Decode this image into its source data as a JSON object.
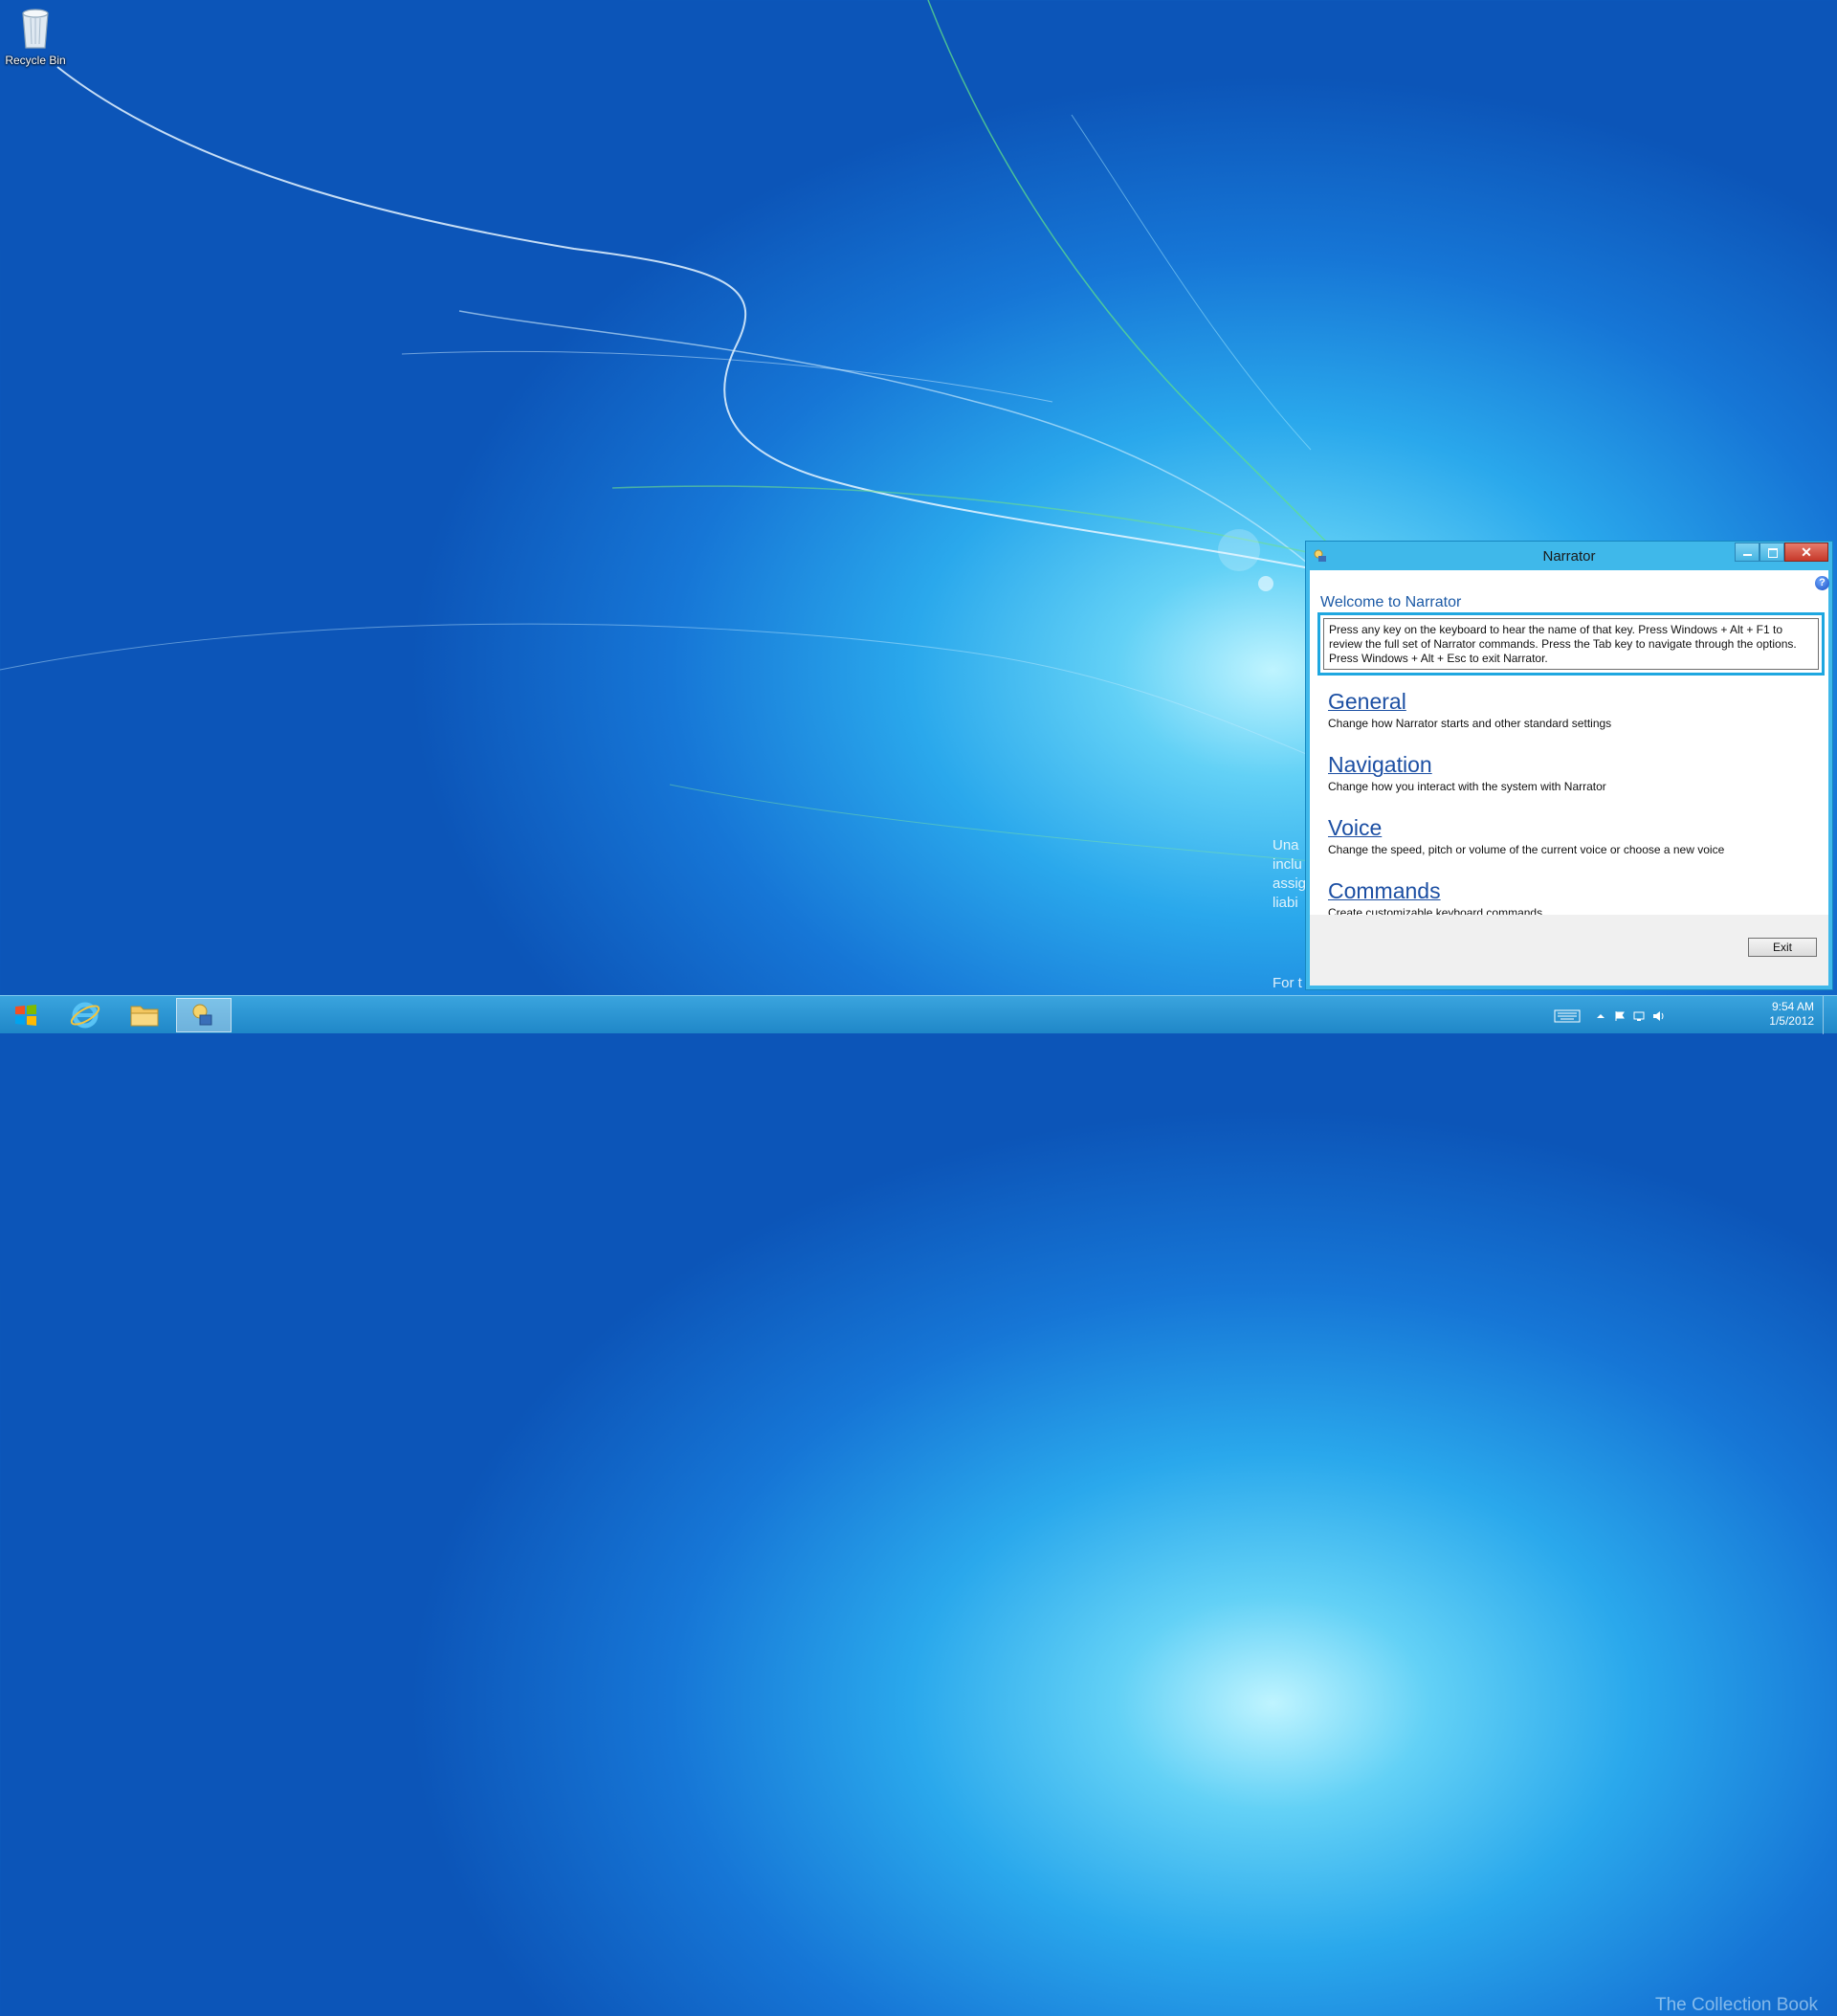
{
  "desktop": {
    "recycle_bin_label": "Recycle Bin",
    "background_text": [
      "Una",
      "inclu",
      "assig",
      "liabi"
    ],
    "background_text_for": "For t"
  },
  "narrator_window": {
    "title": "Narrator",
    "welcome_heading": "Welcome to Narrator",
    "info_lines": [
      "Press any key on the keyboard to hear the name of that key.  Press Windows + Alt + F1 to",
      "review the full set of Narrator commands.  Press the Tab key to navigate through the options.",
      "Press Windows + Alt + Esc to exit Narrator."
    ],
    "sections": [
      {
        "title": "General",
        "description": "Change how Narrator starts and other standard settings"
      },
      {
        "title": "Navigation",
        "description": "Change how you interact with the system with Narrator"
      },
      {
        "title": "Voice",
        "description": "Change the speed, pitch or volume of the current voice or choose a new voice"
      },
      {
        "title": "Commands",
        "description": "Create customizable keyboard commands"
      }
    ],
    "exit_label": "Exit",
    "help_symbol": "?",
    "close_symbol": "✕"
  },
  "taskbar": {
    "apps": [
      "internet-explorer",
      "file-explorer",
      "narrator"
    ],
    "clock_time": "9:54 AM",
    "clock_date": "1/5/2012",
    "watermark": "The Collection Book"
  },
  "colors": {
    "window_frame": "#3fb8ea",
    "link_blue": "#1c4fa3",
    "focus_border": "#1ea7e0",
    "close_button": "#c6392a"
  }
}
